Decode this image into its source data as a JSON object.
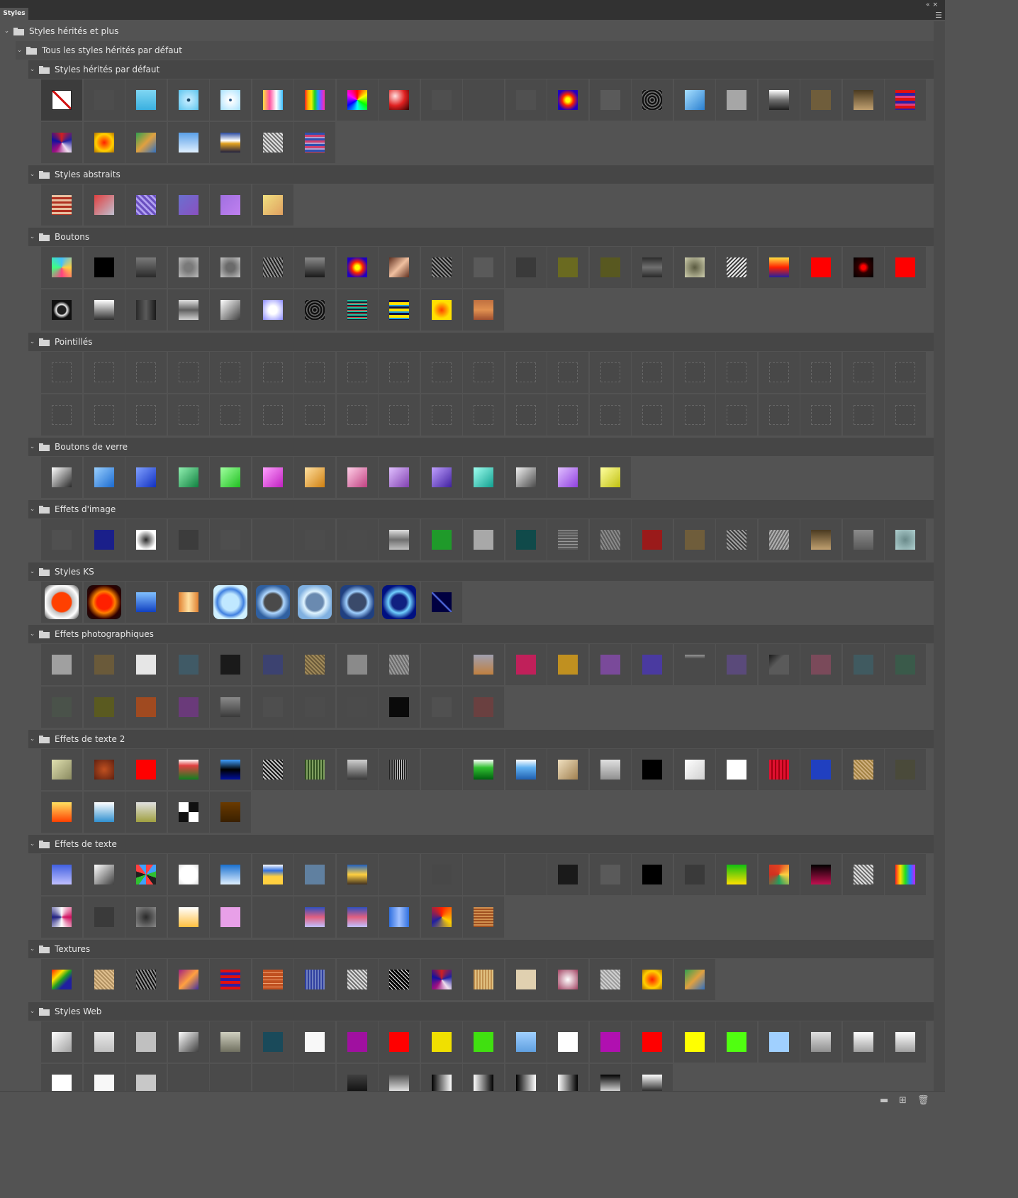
{
  "panel": {
    "tab_label": "Styles",
    "titlebar_icons": [
      "collapse-icon",
      "close-icon"
    ],
    "menu_icon": "panel-menu-icon"
  },
  "tree": {
    "root_label": "Styles hérités et plus",
    "group_label": "Tous les styles hérités par défaut"
  },
  "sections": [
    {
      "label": "Styles hérités par défaut",
      "swatches": [
        "none",
        "#4d4d4d",
        "linear-gradient(180deg,#7fd6f2,#3ab0e0)",
        "radial-gradient(circle,#1a4a6a 0 10%,#bfeaff 14%,#5cc5ee)",
        "radial-gradient(circle,#2a5a8a 0 8%,#ffffff 12%,#a8e2ff)",
        "linear-gradient(90deg,#ffe040,#ff50a0,#ffffff,#40c0ff)",
        "linear-gradient(90deg,#ff2020,#ffb000,#f0f000,#20d020,#20a0ff,#a040ff,#ff30a0)",
        "conic-gradient(#ff0000,#ffff00,#00ff00,#00ffff,#0000ff,#ff00ff,#ff0000)",
        "radial-gradient(circle at 30% 30%,#ffe0e0,#e02020,#300000)",
        "#4f4f4f",
        "#4a4a4a",
        "#505050",
        "radial-gradient(circle,#ffff00 0 15%,#ff2000 40%,#2000c0 75%)",
        "#5a5a5a",
        "repeating-radial-gradient(circle,#111 0 2px,#777 3px 4px)",
        "linear-gradient(135deg,#a8e0ff,#2a7fd0)",
        "#a6a6a6",
        "linear-gradient(180deg,#ffffff,#707070 50%,#202020)",
        "#6f5d3b",
        "linear-gradient(180deg,#4a3a20,#c0a070)",
        "repeating-linear-gradient(180deg,#e01010 0 4px,#3020a0 4px 8px,#e04080 8px 11px)",
        "conic-gradient(#d02020,#2020a0,#f0e0f0,#a01080,#1010a0,#d02020)",
        "radial-gradient(circle,#ff2000,#ffd000 60%,#b07000)",
        "linear-gradient(135deg,#30a050,#e0a040 50%,#3070c0)",
        "linear-gradient(180deg,#5aa0e8,#e0f0ff)",
        "linear-gradient(180deg,#2a4aa0,#ffffff 40%,#e0a020 55%,#202040)",
        "repeating-linear-gradient(45deg,#e0e0e0 0 2px,#707070 2px 4px)",
        "repeating-linear-gradient(180deg,#3050b0 0 3px,#d04070 3px 6px,#b0a0d0 6px 8px)"
      ]
    },
    {
      "label": "Styles abstraits",
      "swatches": [
        "repeating-linear-gradient(180deg,#e8c0a0 0 3px,#b03020 3px 6px)",
        "linear-gradient(135deg,#e04040,#c0c0d0)",
        "repeating-linear-gradient(45deg,#6a50c0 0 3px,#b0a0f0 3px 6px)",
        "linear-gradient(135deg,#6a70d0,#8a50c0)",
        "linear-gradient(135deg,#a070e0,#c080f0)",
        "linear-gradient(135deg,#f0e080,#e0a060)"
      ]
    },
    {
      "label": "Boutons",
      "swatches": [
        "conic-gradient(#40c0ff,#ffd040,#ff4080,#40ff80,#40c0ff)",
        "#000000",
        "linear-gradient(180deg,#7a7a7a,#2a2a2a)",
        "radial-gradient(circle,#7a7a7a 30%,#bdbdbd)",
        "radial-gradient(circle,#6a6a6a 30%,#c6c6c6)",
        "repeating-linear-gradient(60deg,#202020 0 2px,#909090 2px 4px)",
        "linear-gradient(180deg,#8a8a8a,#1a1a1a)",
        "radial-gradient(circle,#ffff00 0 15%,#ff2000 40%,#2000c0 75%)",
        "linear-gradient(135deg,#603020,#f0c0a0,#603020)",
        "repeating-linear-gradient(45deg,#1a1a1a 0 2px,#8a8a8a 2px 4px)",
        "#5a5a5a",
        "#3a3a3a",
        "#6a6a20",
        "#585820",
        "linear-gradient(180deg,#2a2a2a,#707070,#2a2a2a)",
        "radial-gradient(circle,#5a5a40,#d0d0b0)",
        "repeating-linear-gradient(135deg,#eaeaea 0 2px,#3a3a3a 2px 4px)",
        "linear-gradient(180deg,#ffe040,#ff2000 50%,#2020a0)",
        "#ff0000",
        "radial-gradient(circle,#ff0000 0 15%,#300000 40%,#000000)",
        "#ff0000",
        "radial-gradient(circle,#202020 30%,#f0f0f0 38%,#101010 60%)",
        "linear-gradient(180deg,#ffffff,#303030)",
        "linear-gradient(90deg,#2a2a2a,#5a5a5a,#1a1a1a)",
        "linear-gradient(180deg,#e0e0e0,#606060,#d0d0d0)",
        "linear-gradient(135deg,#ffffff,#404040)",
        "radial-gradient(circle,#ffffff 30%,#8a8aff)",
        "repeating-radial-gradient(circle,#101010 0 2px,#6a6a6a 3px 4px)",
        "repeating-linear-gradient(180deg,#20c0a0 0 2px,#102030 2px 4px,#e04040 4px 5px)",
        "repeating-linear-gradient(180deg,#101040 0 3px,#ffe000 3px 7px,#20a0e0 7px 9px)",
        "radial-gradient(circle,#ff4000,#ffe000 60%)",
        "linear-gradient(180deg,#c07040,#e09050,#a05030)"
      ]
    },
    {
      "label": "Pointillés",
      "swatches": [
        "dash",
        "dash",
        "dash",
        "dash",
        "dash",
        "dash",
        "dash",
        "dash",
        "dash",
        "dash",
        "dash",
        "dash",
        "dash",
        "dash",
        "dash",
        "dash",
        "dash",
        "dash",
        "dash",
        "dash",
        "dash",
        "dash",
        "dash",
        "dash",
        "dash",
        "dash",
        "dash",
        "dash",
        "dash",
        "dash",
        "dash",
        "dash",
        "dash",
        "dash",
        "dash",
        "dash",
        "dash",
        "dash",
        "dash",
        "dash",
        "dash",
        "dash"
      ]
    },
    {
      "label": "Boutons de verre",
      "swatches": [
        "linear-gradient(135deg,#ffffff,#2a2a2a)",
        "linear-gradient(135deg,#9ad0ff,#1a6ad0)",
        "linear-gradient(135deg,#80a0ff,#1030c0)",
        "linear-gradient(135deg,#90f0b0,#108040)",
        "linear-gradient(135deg,#a0ffa0,#20c020)",
        "linear-gradient(135deg,#ffa0ff,#c020c0)",
        "linear-gradient(135deg,#ffe0a0,#d08010)",
        "linear-gradient(135deg,#ffd0e8,#c04080)",
        "linear-gradient(135deg,#e0c0ff,#8040b0)",
        "linear-gradient(135deg,#c0a0ff,#4020a0)",
        "linear-gradient(135deg,#a0fff0,#10a090)",
        "linear-gradient(135deg,#f0f0f0,#4a4a4a)",
        "linear-gradient(135deg,#e0c0ff,#9040e0)",
        "linear-gradient(135deg,#ffffa0,#c0c010)"
      ]
    },
    {
      "label": "Effets d'image",
      "swatches": [
        "#505050",
        "#1a1f8a",
        "radial-gradient(circle,#2a2a2a,#ffffff 70%)",
        "#3c3c3c",
        "#4e4e4e",
        "#4a4a4a",
        "#4c4c4c",
        "#4b4b4b",
        "linear-gradient(180deg,#e0e0e0,#707070,#c0c0c0)",
        "#1f9a2a",
        "#a8a8a8",
        "#104a4a",
        "repeating-linear-gradient(0deg,#5a5a5a 0 3px,#9a9a9a 3px 4px)",
        "repeating-linear-gradient(60deg,#5a5a5a 0 2px,#8a8a8a 2px 4px)",
        "#9a1a1a",
        "#6f5d3b",
        "repeating-linear-gradient(45deg,#3a3a3a 0 2px,#a0a0a0 2px 4px)",
        "repeating-linear-gradient(120deg,#6a6a6a 0 2px,#b0b0b0 2px 4px)",
        "linear-gradient(180deg,#4a3a20,#c0a070)",
        "linear-gradient(180deg,#8a8a8a,#5a5a5a)",
        "radial-gradient(circle,#6a8a8a,#b0d0d0)"
      ]
    },
    {
      "label": "Styles KS",
      "swatches": [
        "radial-gradient(circle,#ff4000 0 40%,#c0c0c0 45%,#ffffff 70%,#404040)",
        "radial-gradient(circle,#ff2000 0 30%,#ff8000 45%,#300000 70%,#101010)",
        "linear-gradient(180deg,#80c0ff,#1040c0)",
        "linear-gradient(90deg,#e08030,#ffe0a0,#e08030)",
        "radial-gradient(circle,#c0e8ff 0 35%,#4080e0 55%,#d0f0ff 70%)",
        "radial-gradient(circle,#4a4a4a 0 35%,#b0d8ff 45%,#3060a0 70%)",
        "radial-gradient(circle,#6a8ab0 0 35%,#e0f4ff 45%,#80b0e0 70%)",
        "radial-gradient(circle,#3a4a6a 0 35%,#a0d0ff 45%,#204080 70%)",
        "radial-gradient(circle,#102080 0 30%,#70d0ff 45%,#001080 70%)",
        "linear-gradient(45deg,#000040,#000040 45%,#6080ff 50%,#000040 55%)"
      ]
    },
    {
      "label": "Effets photographiques",
      "swatches": [
        "#a0a0a0",
        "#6a5a3a",
        "#e6e6e6",
        "#405a66",
        "#1a1a1a",
        "#3c4270",
        "repeating-linear-gradient(45deg,#6a5a3a 0 2px,#a08a5a 2px 4px)",
        "#8a8a8a",
        "repeating-linear-gradient(60deg,#6a6a6a 0 2px,#9a9a9a 2px 4px)",
        "#4a4a4a",
        "linear-gradient(180deg,#a0a0b0,#c08040)",
        "#c0205a",
        "#c09020",
        "#7a4a9a",
        "#4a3aa0",
        "linear-gradient(180deg,#9a9a9a,#4a4a4a 20%)",
        "#5a4a7a",
        "linear-gradient(135deg,#1a1a1a,#5a5a5a 40%)",
        "#7a4a5a",
        "#405a60",
        "#3a5a4a",
        "#4a524a",
        "#5a5a20",
        "#a04a20",
        "#6a3a7a",
        "linear-gradient(180deg,#8a8a8a,#3a3a3a)",
        "#4e4e4e",
        "#4c4c4c",
        "#4b4b4b",
        "#0a0a0a",
        "#505050",
        "#6a4040"
      ]
    },
    {
      "label": "Effets de texte 2",
      "swatches": [
        "linear-gradient(135deg,#e0e0b0,#8a8a60)",
        "radial-gradient(circle,#c05020,#602010)",
        "#ff0000",
        "linear-gradient(180deg,#ffffff,#e04040 30%,#108020)",
        "linear-gradient(180deg,#40a0ff,#000000 50%,#0010a0)",
        "repeating-linear-gradient(45deg,#101010 0 2px,#c0c0c0 2px 4px)",
        "repeating-linear-gradient(90deg,#305020 0 2px,#80a060 2px 4px)",
        "linear-gradient(180deg,#d0d0d0,#3a3a3a)",
        "repeating-linear-gradient(90deg,#202020 0 2px,#d0d0d0 2px 3px)",
        "#4a4a4a",
        "linear-gradient(180deg,#ffffff,#30c030 40%,#006010)",
        "linear-gradient(180deg,#ffffff,#60b0f0 40%,#2060b0)",
        "linear-gradient(135deg,#f0e0c0,#a08050)",
        "linear-gradient(180deg,#e0e0e0,#909090)",
        "#000000",
        "linear-gradient(135deg,#ffffff,#d0d0d0)",
        "#ffffff",
        "repeating-linear-gradient(90deg,#e01030 0 3px,#a00010 3px 5px)",
        "#2040c0",
        "repeating-linear-gradient(45deg,#a08040 0 2px,#d0b080 2px 4px)",
        "#4a4a3a",
        "linear-gradient(180deg,#ffe060,#ff4000)",
        "linear-gradient(180deg,#ffffff,#3090d0)",
        "linear-gradient(180deg,#e0e0e0,#a0a040)",
        "repeating-conic-gradient(#101010 0 25%,#ffffff 0 50%)",
        "linear-gradient(180deg,#6a3a00,#3a2000)"
      ]
    },
    {
      "label": "Effets de texte",
      "swatches": [
        "linear-gradient(180deg,#4060e0,#c0c0ff)",
        "linear-gradient(135deg,#ffffff,#404040)",
        "repeating-conic-gradient(#ff4040 0 10%,#40a0ff 0 20%,#30c030 0 30%,#202020 0 40%)",
        "radial-gradient(circle,#ffffff 60%,#e0e0e0)",
        "linear-gradient(180deg,#1a70d0,#e0f0ff)",
        "linear-gradient(180deg,#ffffff,#3070e0 30%,#ffd040 60%)",
        "#6080a0",
        "linear-gradient(180deg,#2060c0,#ffd040 50%,#403020)",
        "#4a4a4a",
        "#484848",
        "#4a4a4a",
        "#4a4a4a",
        "#1a1a1a",
        "#5a5a5a",
        "#000000",
        "#3a3a3a",
        "linear-gradient(180deg,#10c010,#ffe000)",
        "conic-gradient(#e04020,#ffd040,#20a060,#d03020,#e04020)",
        "linear-gradient(180deg,#000000,#c01050)",
        "repeating-linear-gradient(45deg,#e0e0e0 0 2px,#6a6a6a 2px 4px)",
        "linear-gradient(90deg,#ff2020,#ffe000,#20e020,#2080ff,#c020ff)",
        "conic-gradient(#ffffff,#d01060,#ffffff,#202080,#ffffff)",
        "#3a3a3a",
        "radial-gradient(circle,#2a2a2a,#8a8a8a)",
        "linear-gradient(180deg,#ffffff,#ffc040)",
        "#e8a0e8",
        "#4a4a4a",
        "linear-gradient(180deg,#3050c0,#e06080,#c0c0ff)",
        "linear-gradient(180deg,#3050c0,#e06080,#c0c0ff)",
        "linear-gradient(90deg,#3070e0,#a0c0ff,#3070e0)",
        "conic-gradient(#ff2000,#ffd000,#2020a0,#ff2000)",
        "repeating-linear-gradient(0deg,#a05020 0 2px,#d09050 2px 4px)"
      ]
    },
    {
      "label": "Textures",
      "swatches": [
        "linear-gradient(135deg,#ff2000,#ffe000 30%,#20a020 50%,#2020a0 70%)",
        "repeating-linear-gradient(45deg,#b09060 0 2px,#e0c090 2px 4px)",
        "repeating-linear-gradient(60deg,#101010 0 2px,#909090 2px 4px)",
        "linear-gradient(135deg,#a02080,#ffa040 50%,#4030a0)",
        "repeating-linear-gradient(180deg,#e01010 0 4px,#3020a0 4px 8px)",
        "repeating-linear-gradient(180deg,#c05020 0 4px,#f0a070 4px 5px)",
        "repeating-linear-gradient(90deg,#3040a0 0 2px,#7080c0 2px 4px)",
        "repeating-linear-gradient(45deg,#707070 0 2px,#e0e0e0 2px 4px)",
        "repeating-linear-gradient(45deg,#000000 0 3px,#ffffff 3px 4px)",
        "conic-gradient(#d02020,#2020a0,#f0e0f0,#a01080,#1010a0,#d02020)",
        "repeating-linear-gradient(90deg,#c09050 0 2px,#e0c080 2px 4px)",
        "#e0d0b0",
        "radial-gradient(circle,#ffffff,#a04060)",
        "repeating-linear-gradient(45deg,#9a9a9a 0 2px,#d0d0d0 2px 4px)",
        "radial-gradient(circle,#ff2000,#ffd000 60%,#b07000)",
        "linear-gradient(135deg,#30a050,#e0a040 50%,#3070c0)"
      ]
    },
    {
      "label": "Styles Web",
      "swatches": [
        "linear-gradient(135deg,#ffffff,#a0a0a0)",
        "linear-gradient(180deg,#e8e8e8,#c0c0c0)",
        "#c0c0c0",
        "linear-gradient(135deg,#ffffff,#404040)",
        "linear-gradient(180deg,#d0d0c0,#707060)",
        "#1a4a5a",
        "#f8f8f8",
        "#a010a0",
        "#ff0000",
        "#f0e000",
        "#40e010",
        "linear-gradient(180deg,#a0d0ff,#60a0e0)",
        "#ffffff",
        "#b010b0",
        "#ff0000",
        "#ffff00",
        "#50ff10",
        "#a0d0ff",
        "linear-gradient(180deg,#e0e0e0,#909090)",
        "linear-gradient(180deg,#ffffff,#a0a0a0)",
        "linear-gradient(180deg,#ffffff,#a0a0a0)",
        "#ffffff",
        "#f8f8f8",
        "#c8c8c8",
        "#4a4a4a",
        "#4a4a4a",
        "#4a4a4a",
        "#4a4a4a",
        "linear-gradient(180deg,#404040,#0a0a0a)",
        "linear-gradient(180deg,#505050,#ffffff)",
        "linear-gradient(90deg,#000000,#ffffff)",
        "linear-gradient(90deg,#ffffff,#000000)",
        "linear-gradient(90deg,#000000,#ffffff)",
        "linear-gradient(90deg,#ffffff,#000000)",
        "linear-gradient(180deg,#000000,#ffffff)",
        "linear-gradient(180deg,#ffffff,#000000)"
      ]
    }
  ],
  "footer": {
    "icons": [
      "new-group-icon",
      "new-style-icon",
      "delete-icon"
    ]
  }
}
